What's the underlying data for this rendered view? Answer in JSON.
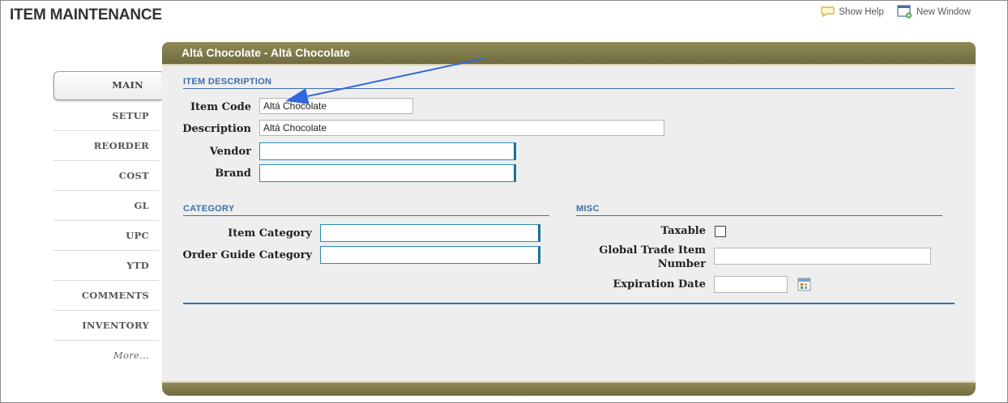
{
  "page": {
    "title": "ITEM MAINTENANCE"
  },
  "top_links": {
    "show_help": "Show Help",
    "new_window": "New Window"
  },
  "tabs": [
    {
      "label": "MAIN",
      "active": true
    },
    {
      "label": "SETUP"
    },
    {
      "label": "REORDER"
    },
    {
      "label": "COST"
    },
    {
      "label": "GL"
    },
    {
      "label": "UPC"
    },
    {
      "label": "YTD"
    },
    {
      "label": "COMMENTS"
    },
    {
      "label": "INVENTORY"
    },
    {
      "label": "More..."
    }
  ],
  "panel": {
    "header": "Altá Chocolate - Altá Chocolate"
  },
  "item_description": {
    "title": "ITEM DESCRIPTION",
    "item_code_label": "Item Code",
    "item_code_value": "Altá Chocolate",
    "description_label": "Description",
    "description_value": "Altá Chocolate",
    "vendor_label": "Vendor",
    "vendor_value": "",
    "brand_label": "Brand",
    "brand_value": ""
  },
  "category": {
    "title": "CATEGORY",
    "item_category_label": "Item Category",
    "item_category_value": "",
    "order_guide_label": "Order Guide Category",
    "order_guide_value": ""
  },
  "misc": {
    "title": "MISC",
    "taxable_label": "Taxable",
    "taxable_checked": false,
    "gtin_label_line1": "Global Trade Item",
    "gtin_label_line2": "Number",
    "gtin_value": "",
    "expiration_label": "Expiration Date",
    "expiration_value": ""
  },
  "colors": {
    "header_bar": "#7d7849",
    "section_blue": "#3d6ea8",
    "annotation_arrow": "#3366dd"
  }
}
